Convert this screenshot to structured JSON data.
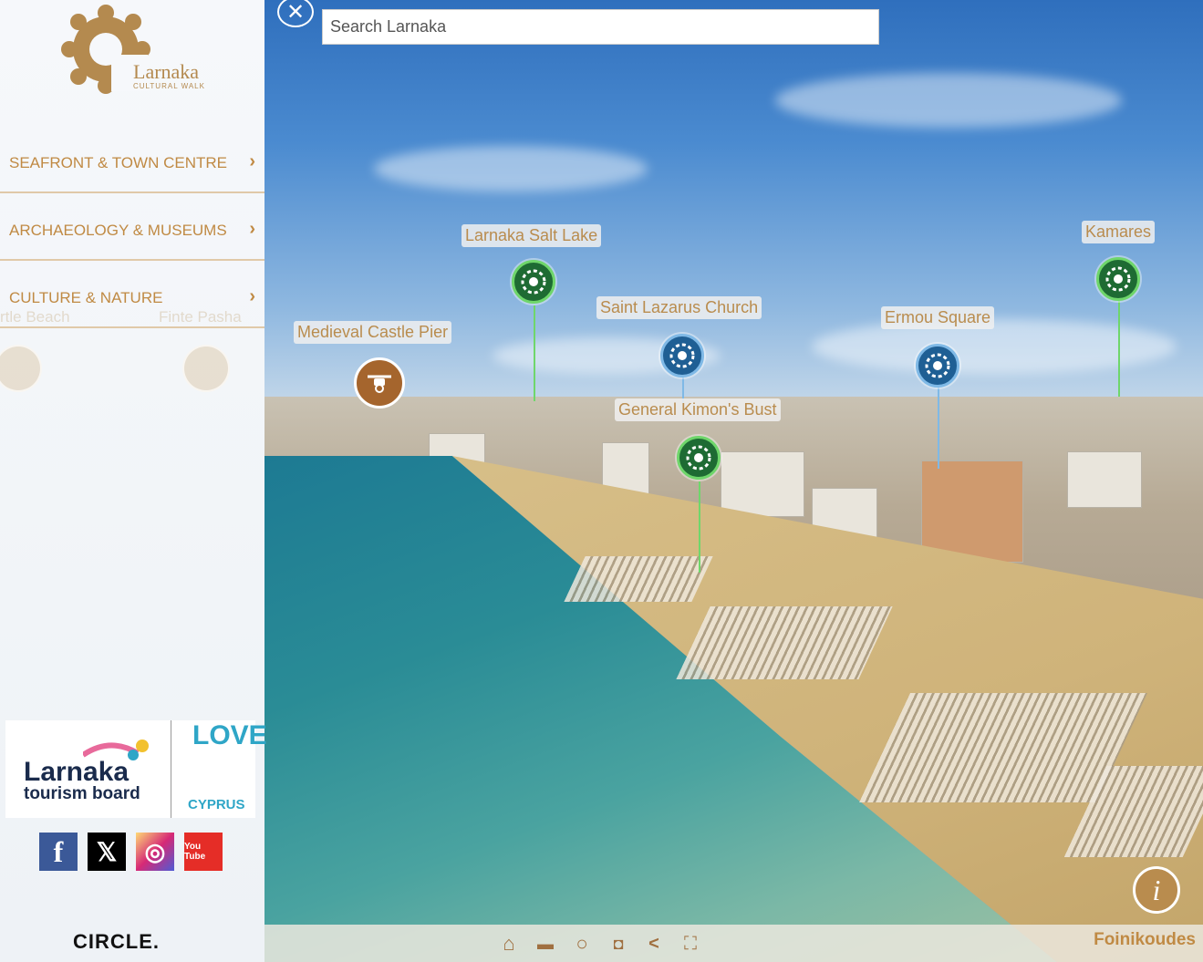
{
  "search": {
    "placeholder": "Search Larnaka"
  },
  "brand": {
    "name": "Larnaka",
    "subtitle": "CULTURAL WALK"
  },
  "menu": [
    {
      "label": "SEAFRONT & TOWN CENTRE"
    },
    {
      "label": "ARCHAEOLOGY & MUSEUMS"
    },
    {
      "label": "CULTURE & NATURE"
    }
  ],
  "ghost_labels": [
    "rtle Beach",
    "Finte Pasha"
  ],
  "sponsor": {
    "tourism_1": "Larnaka",
    "tourism_2": "tourism board",
    "love": "LOVE",
    "cyprus": "CYPRUS"
  },
  "social": [
    {
      "name": "facebook",
      "glyph": "f",
      "color": "#3b5998"
    },
    {
      "name": "x",
      "glyph": "𝕏",
      "color": "#000000"
    },
    {
      "name": "instagram",
      "glyph": "◎",
      "color": "#c13584"
    },
    {
      "name": "youtube",
      "glyph": "You Tube",
      "color": "#e52d27"
    }
  ],
  "footer_brand": "CIRCLE.",
  "hotspots": [
    {
      "label": "Larnaka Salt Lake",
      "type": "green"
    },
    {
      "label": "Kamares",
      "type": "green"
    },
    {
      "label": "Saint Lazarus Church",
      "type": "blue"
    },
    {
      "label": "Ermou Square",
      "type": "blue"
    },
    {
      "label": "Medieval Castle Pier",
      "type": "drone"
    },
    {
      "label": "General Kimon's Bust",
      "type": "green"
    }
  ],
  "toolbar": {
    "home": "⌂",
    "map": "▬",
    "vr": "○",
    "camera": "◘",
    "share": "<",
    "fullscreen": "⛶"
  },
  "location": "Foinikoudes",
  "info": "i",
  "colors": {
    "accent": "#c08a44",
    "green_pin": "#1e6b33",
    "blue_pin": "#1f5f94"
  }
}
